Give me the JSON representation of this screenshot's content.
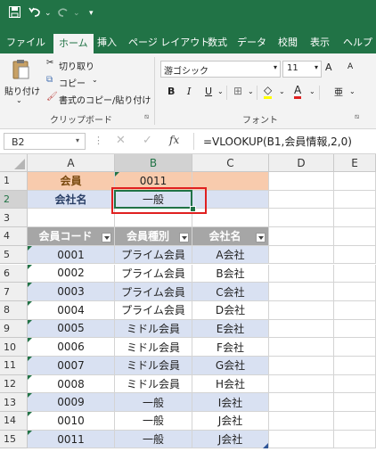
{
  "quick_access": {
    "save_icon": "save-icon",
    "undo_icon": "undo-icon",
    "redo_icon": "redo-icon"
  },
  "tabs": [
    {
      "label": "ファイル"
    },
    {
      "label": "ホーム"
    },
    {
      "label": "挿入"
    },
    {
      "label": "ページ レイアウト"
    },
    {
      "label": "数式"
    },
    {
      "label": "データ"
    },
    {
      "label": "校閲"
    },
    {
      "label": "表示"
    },
    {
      "label": "ヘルプ"
    }
  ],
  "clipboard": {
    "paste": "貼り付け",
    "cut": "切り取り",
    "copy": "コピー",
    "format_painter": "書式のコピー/貼り付け",
    "group_label": "クリップボード"
  },
  "font": {
    "name": "游ゴシック",
    "size": "11",
    "group_label": "フォント",
    "grow": "A",
    "shrink": "A",
    "bold": "B",
    "italic": "I",
    "underline": "U",
    "font_color": "A",
    "phonetic": "亜"
  },
  "formula_bar": {
    "name_box": "B2",
    "formula": "=VLOOKUP(B1,会員情報,2,0)",
    "fx": "fx"
  },
  "columns": [
    "A",
    "B",
    "C",
    "D",
    "E"
  ],
  "rows": [
    {
      "num": "1",
      "a": "会員",
      "b": "0011",
      "c": ""
    },
    {
      "num": "2",
      "a": "会社名",
      "b": "一般",
      "c": ""
    },
    {
      "num": "3",
      "a": "",
      "b": "",
      "c": ""
    },
    {
      "num": "4",
      "a": "会員コード",
      "b": "会員種別",
      "c": "会社名"
    },
    {
      "num": "5",
      "a": "0001",
      "b": "プライム会員",
      "c": "A会社"
    },
    {
      "num": "6",
      "a": "0002",
      "b": "プライム会員",
      "c": "B会社"
    },
    {
      "num": "7",
      "a": "0003",
      "b": "プライム会員",
      "c": "C会社"
    },
    {
      "num": "8",
      "a": "0004",
      "b": "プライム会員",
      "c": "D会社"
    },
    {
      "num": "9",
      "a": "0005",
      "b": "ミドル会員",
      "c": "E会社"
    },
    {
      "num": "10",
      "a": "0006",
      "b": "ミドル会員",
      "c": "F会社"
    },
    {
      "num": "11",
      "a": "0007",
      "b": "ミドル会員",
      "c": "G会社"
    },
    {
      "num": "12",
      "a": "0008",
      "b": "ミドル会員",
      "c": "H会社"
    },
    {
      "num": "13",
      "a": "0009",
      "b": "一般",
      "c": "I会社"
    },
    {
      "num": "14",
      "a": "0010",
      "b": "一般",
      "c": "J会社"
    },
    {
      "num": "15",
      "a": "0011",
      "b": "一般",
      "c": "J会社"
    }
  ],
  "colors": {
    "excel_green": "#217346",
    "orange_fill": "#f8cbad",
    "blue_fill": "#d9e1f2",
    "header_gray": "#a6a6a6",
    "highlight_red": "#e02020"
  }
}
